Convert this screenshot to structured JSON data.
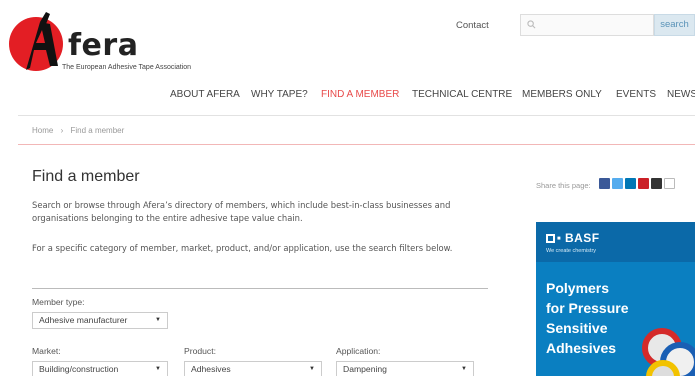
{
  "header": {
    "logo_text": "fera",
    "logo_tagline": "The European Adhesive Tape Association",
    "contact_label": "Contact",
    "search_placeholder": "",
    "search_button": "search"
  },
  "nav": {
    "items": [
      "ABOUT AFERA",
      "WHY TAPE?",
      "FIND A MEMBER",
      "TECHNICAL CENTRE",
      "MEMBERS ONLY",
      "EVENTS",
      "NEWS"
    ],
    "active_index": 2
  },
  "breadcrumb": {
    "home": "Home",
    "separator": "›",
    "current": "Find a member"
  },
  "main": {
    "title": "Find a member",
    "intro": "Search or browse through Afera’s directory of members, which include best-in-class businesses and organisations belonging to the entire adhesive tape value chain.",
    "intro2": "For a specific category of member, market, product, and/or application, use the search filters below.",
    "filters": {
      "member_type_label": "Member type:",
      "member_type_value": "Adhesive manufacturer",
      "market_label": "Market:",
      "market_value": "Building/construction",
      "product_label": "Product:",
      "product_value": "Adhesives",
      "application_label": "Application:",
      "application_value": "Dampening"
    }
  },
  "sidebar": {
    "share_label": "Share this page:",
    "ad": {
      "brand": "BASF",
      "tagline": "We create chemistry",
      "line1": "Polymers",
      "line2": "for Pressure",
      "line3": "Sensitive",
      "line4": "Adhesives"
    }
  },
  "colors": {
    "accent": "#e84a4a",
    "search_button_bg": "#dbe8f0",
    "ad_blue": "#0a7fc1"
  }
}
